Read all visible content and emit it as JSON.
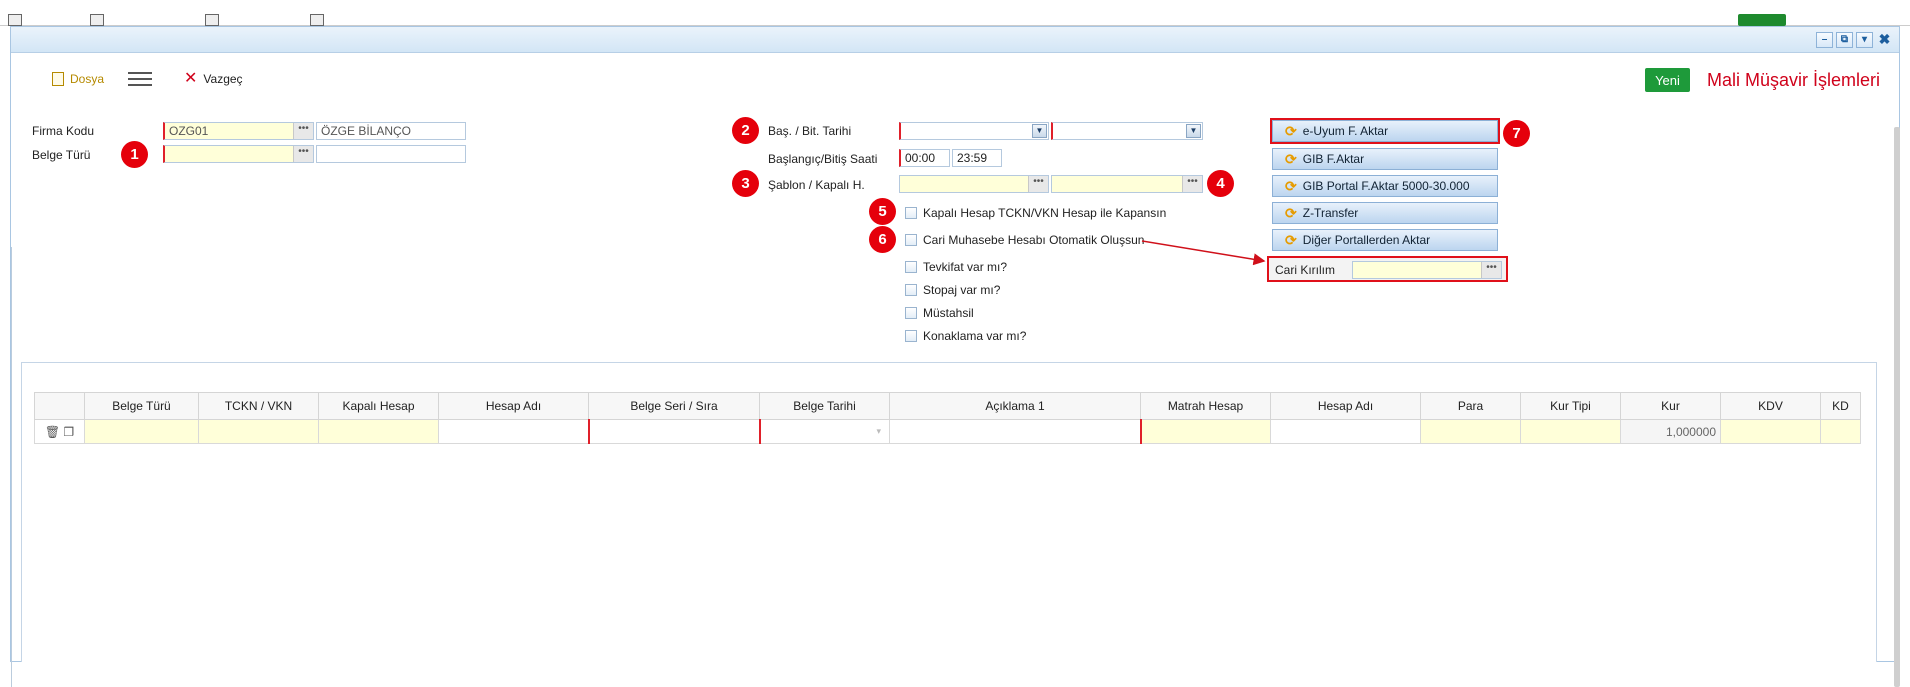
{
  "header": {
    "dosya": "Dosya",
    "vazgec": "Vazgeç",
    "yeni": "Yeni",
    "title": "Mali Müşavir İşlemleri"
  },
  "form": {
    "firma_kodu_label": "Firma Kodu",
    "firma_kodu_value": "OZG01",
    "firma_adi_value": "ÖZGE BİLANÇO",
    "belge_turu_label": "Belge Türü",
    "bas_bit_tarihi_label": "Baş. / Bit. Tarihi",
    "saat_label": "Başlangıç/Bitiş Saati",
    "baslangic_saati": "00:00",
    "bitis_saati": "23:59",
    "sablon_label": "Şablon / Kapalı H."
  },
  "checkboxes": {
    "kapali_hesap": "Kapalı Hesap TCKN/VKN Hesap ile Kapansın",
    "cari_muhasebe": "Cari Muhasebe Hesabı Otomatik Oluşsun",
    "tevkifat": "Tevkifat var mı?",
    "stopaj": "Stopaj var mı?",
    "mustahsil": "Müstahsil",
    "konaklama": "Konaklama var mı?"
  },
  "actions": {
    "e_uyum": "e-Uyum F. Aktar",
    "gib": "GIB F.Aktar",
    "gib_portal": "GIB Portal F.Aktar 5000-30.000",
    "z_transfer": "Z-Transfer",
    "diger": "Diğer Portallerden Aktar",
    "cari_kirilim": "Cari Kırılım"
  },
  "badges": [
    "1",
    "2",
    "3",
    "4",
    "5",
    "6",
    "7"
  ],
  "grid": {
    "columns": [
      "Belge Türü",
      "TCKN / VKN",
      "Kapalı Hesap",
      "Hesap Adı",
      "Belge Seri / Sıra",
      "Belge Tarihi",
      "Açıklama 1",
      "Matrah Hesap",
      "Hesap Adı",
      "Para",
      "Kur Tipi",
      "Kur",
      "KDV",
      "KD"
    ],
    "kur_value": "1,000000"
  },
  "colors": {
    "accent_red": "#e5000b",
    "yeni_green": "#1e9a3a",
    "required_yellow": "#ffffd9"
  }
}
